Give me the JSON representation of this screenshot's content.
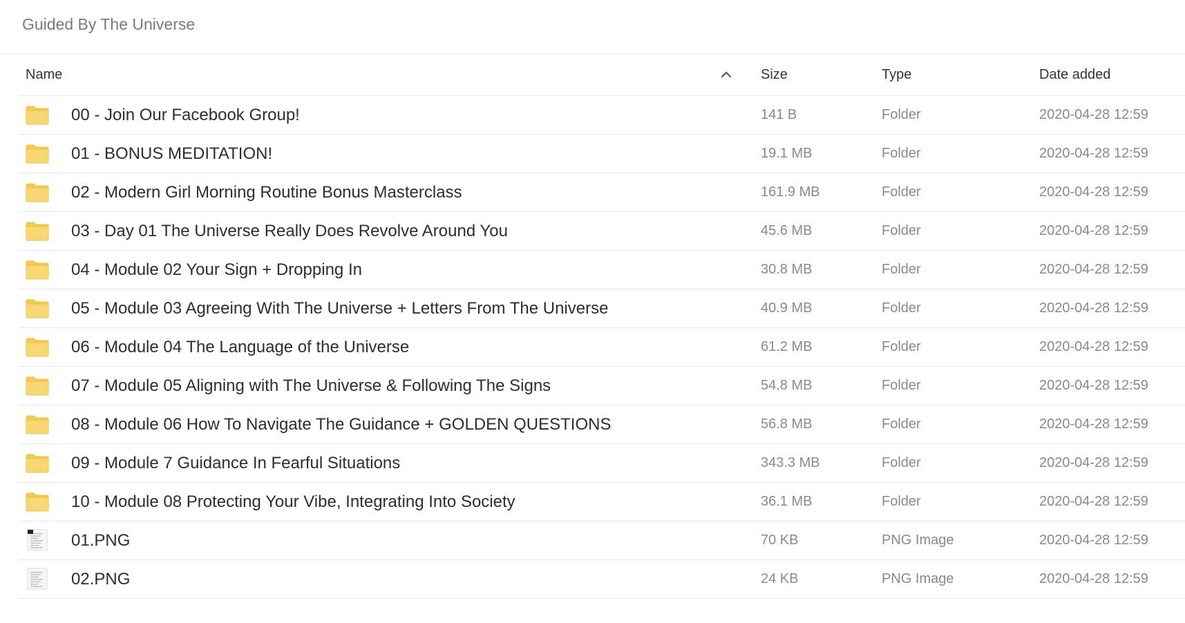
{
  "breadcrumb": {
    "title": "Guided By The Universe"
  },
  "columns": {
    "name": "Name",
    "size": "Size",
    "type": "Type",
    "date": "Date added",
    "sort": "ascending",
    "sort_icon": "chevron-up-icon"
  },
  "colors": {
    "folder_fill": "#f8d775",
    "folder_border": "#f0c23e",
    "folder_tab": "#f5ca4a"
  },
  "rows": [
    {
      "icon": "folder-icon",
      "name": "00 - Join Our Facebook Group!",
      "size": "141 B",
      "type": "Folder",
      "date": "2020-04-28 12:59"
    },
    {
      "icon": "folder-icon",
      "name": "01 - BONUS MEDITATION!",
      "size": "19.1 MB",
      "type": "Folder",
      "date": "2020-04-28 12:59"
    },
    {
      "icon": "folder-icon",
      "name": "02 - Modern Girl Morning Routine Bonus Masterclass",
      "size": "161.9 MB",
      "type": "Folder",
      "date": "2020-04-28 12:59"
    },
    {
      "icon": "folder-icon",
      "name": "03 - Day 01 The Universe Really Does Revolve Around You",
      "size": "45.6 MB",
      "type": "Folder",
      "date": "2020-04-28 12:59"
    },
    {
      "icon": "folder-icon",
      "name": "04 - Module 02 Your Sign + Dropping In",
      "size": "30.8 MB",
      "type": "Folder",
      "date": "2020-04-28 12:59"
    },
    {
      "icon": "folder-icon",
      "name": "05 - Module 03 Agreeing With The Universe + Letters From The Universe",
      "size": "40.9 MB",
      "type": "Folder",
      "date": "2020-04-28 12:59"
    },
    {
      "icon": "folder-icon",
      "name": "06 - Module 04 The Language of the Universe",
      "size": "61.2 MB",
      "type": "Folder",
      "date": "2020-04-28 12:59"
    },
    {
      "icon": "folder-icon",
      "name": "07 - Module 05 Aligning with The Universe & Following The Signs",
      "size": "54.8 MB",
      "type": "Folder",
      "date": "2020-04-28 12:59"
    },
    {
      "icon": "folder-icon",
      "name": "08 - Module 06 How To Navigate The Guidance + GOLDEN QUESTIONS",
      "size": "56.8 MB",
      "type": "Folder",
      "date": "2020-04-28 12:59"
    },
    {
      "icon": "folder-icon",
      "name": "09 - Module 7 Guidance In Fearful Situations",
      "size": "343.3 MB",
      "type": "Folder",
      "date": "2020-04-28 12:59"
    },
    {
      "icon": "folder-icon",
      "name": "10 - Module 08 Protecting Your Vibe, Integrating Into Society",
      "size": "36.1 MB",
      "type": "Folder",
      "date": "2020-04-28 12:59"
    },
    {
      "icon": "png-thumbnail-icon",
      "name": "01.PNG",
      "size": "70 KB",
      "type": "PNG Image",
      "date": "2020-04-28 12:59"
    },
    {
      "icon": "png-thumbnail-icon",
      "name": "02.PNG",
      "size": "24 KB",
      "type": "PNG Image",
      "date": "2020-04-28 12:59"
    }
  ]
}
